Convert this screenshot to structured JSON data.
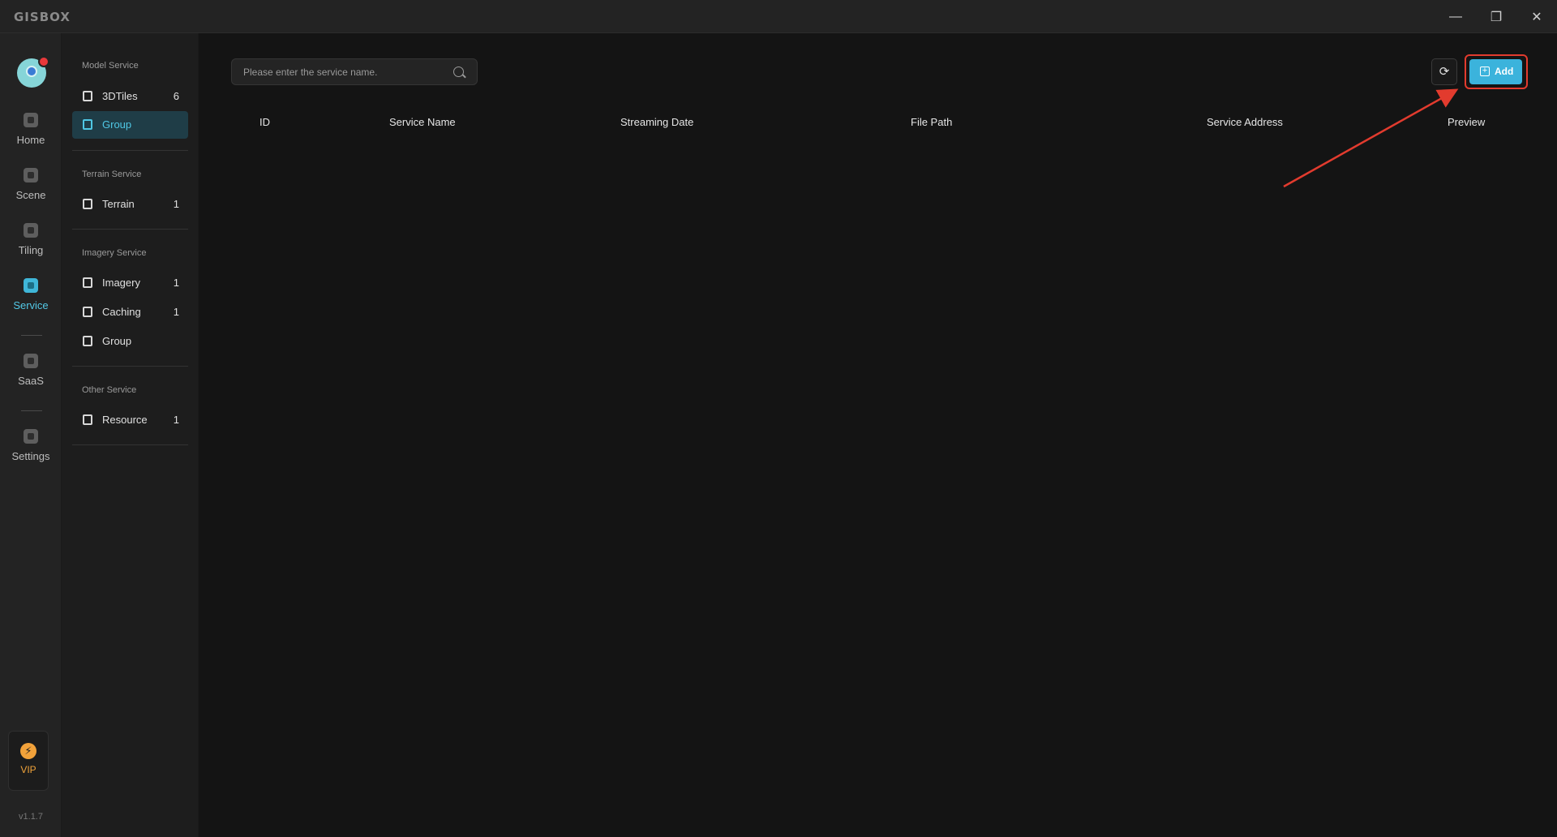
{
  "app": {
    "logo": "GISBOX"
  },
  "window": {
    "minimize": "—",
    "restore": "❐",
    "close": "✕"
  },
  "nav": {
    "items": [
      {
        "label": "Home",
        "icon": "home-icon"
      },
      {
        "label": "Scene",
        "icon": "scene-icon"
      },
      {
        "label": "Tiling",
        "icon": "tiling-icon"
      },
      {
        "label": "Service",
        "icon": "service-icon",
        "active": true
      },
      {
        "label": "SaaS",
        "icon": "saas-icon"
      },
      {
        "label": "Settings",
        "icon": "settings-icon"
      }
    ],
    "vip": {
      "label": "VIP",
      "icon": "⚡"
    },
    "version": "v1.1.7"
  },
  "subnav": {
    "groups": [
      {
        "title": "Model Service",
        "items": [
          {
            "label": "3DTiles",
            "count": "6"
          },
          {
            "label": "Group",
            "count": "",
            "active": true
          }
        ]
      },
      {
        "title": "Terrain Service",
        "items": [
          {
            "label": "Terrain",
            "count": "1"
          }
        ]
      },
      {
        "title": "Imagery Service",
        "items": [
          {
            "label": "Imagery",
            "count": "1"
          },
          {
            "label": "Caching",
            "count": "1"
          },
          {
            "label": "Group",
            "count": ""
          }
        ]
      },
      {
        "title": "Other Service",
        "items": [
          {
            "label": "Resource",
            "count": "1"
          }
        ]
      }
    ]
  },
  "search": {
    "placeholder": "Please enter the service name.",
    "value": ""
  },
  "toolbar": {
    "refresh_icon": "⟳",
    "add_icon": "+",
    "add_label": "Add"
  },
  "annotation": {
    "color": "#e23b2e"
  },
  "table": {
    "columns": [
      "ID",
      "Service Name",
      "Streaming Date",
      "File Path",
      "Service Address",
      "Preview"
    ],
    "rows": []
  },
  "colors": {
    "accent": "#3bb3dc",
    "active_bg": "#1f3d47",
    "highlight": "#e23b2e",
    "vip": "#f0a33a"
  }
}
